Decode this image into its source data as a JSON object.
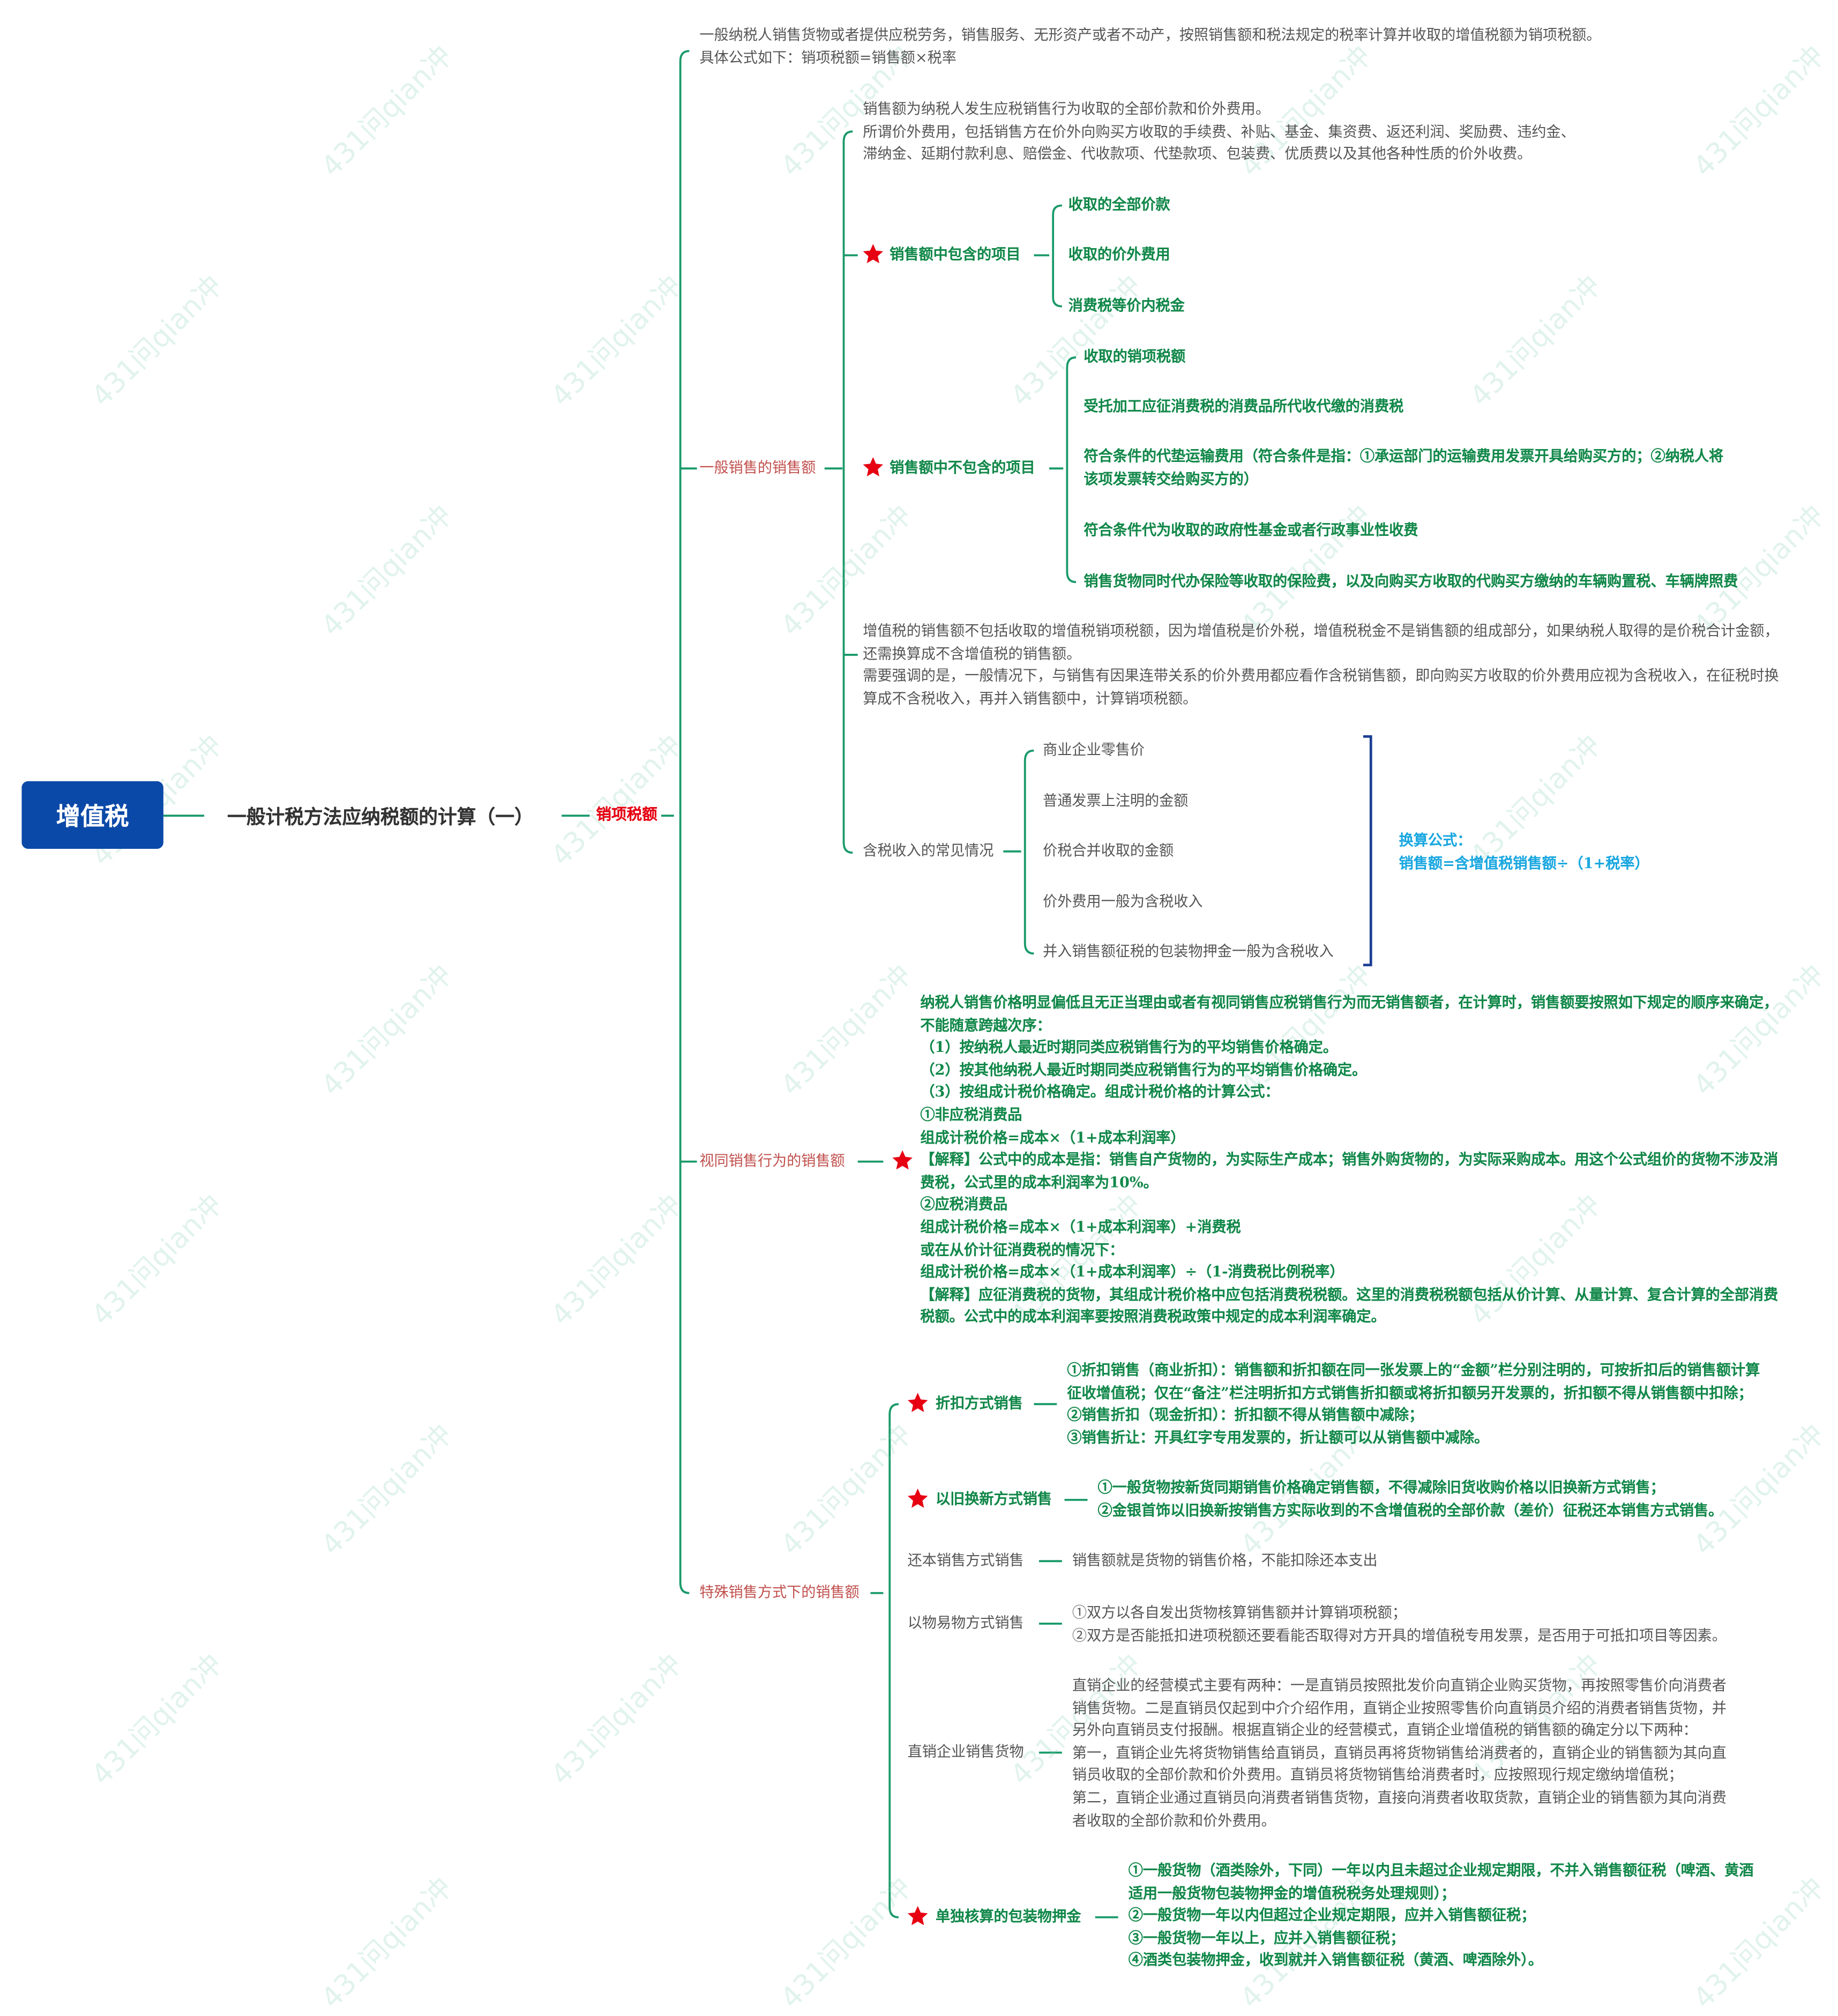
{
  "root": {
    "label": "增值税"
  },
  "l1": {
    "label": "一般计税方法应纳税额的计算（一）"
  },
  "l2": {
    "label": "销项税额"
  },
  "intro": {
    "text": "一般纳税人销售货物或者提供应税劳务，销售服务、无形资产或者不动产，按照销售额和税法规定的税率计算并收取的增值税额为销项税额。\n具体公式如下：销项税额=销售额×税率"
  },
  "general": {
    "label": "一般销售的销售额",
    "def_text": "销售额为纳税人发生应税销售行为收取的全部价款和价外费用。\n所谓价外费用，包括销售方在价外向购买方收取的手续费、补贴、基金、集资费、返还利润、奖励费、违约金、\n滞纳金、延期付款利息、赔偿金、代收款项、代垫款项、包装费、优质费以及其他各种性质的价外收费。",
    "included": {
      "label": "销售额中包含的项目",
      "items": [
        "收取的全部价款",
        "收取的价外费用",
        "消费税等价内税金"
      ]
    },
    "excluded": {
      "label": "销售额中不包含的项目",
      "items": [
        "收取的销项税额",
        "受托加工应征消费税的消费品所代收代缴的消费税",
        "符合条件的代垫运输费用（符合条件是指：①承运部门的运输费用发票开具给购买方的；②纳税人将\n该项发票转交给购买方的）",
        "符合条件代为收取的政府性基金或者行政事业性收费",
        "销售货物同时代办保险等收取的保险费，以及向购买方收取的代购买方缴纳的车辆购置税、车辆牌照费"
      ]
    },
    "note_text": "增值税的销售额不包括收取的增值税销项税额，因为增值税是价外税，增值税税金不是销售额的组成部分，如果纳税人取得的是价税合计金额，\n还需换算成不含增值税的销售额。\n需要强调的是，一般情况下，与销售有因果连带关系的价外费用都应看作含税销售额，即向购买方收取的价外费用应视为含税收入，在征税时换\n算成不含税收入，再并入销售额中，计算销项税额。",
    "tax_inclusive": {
      "label": "含税收入的常见情况",
      "items": [
        "商业企业零售价",
        "普通发票上注明的金额",
        "价税合并收取的金额",
        "价外费用一般为含税收入",
        "并入销售额征税的包装物押金一般为含税收入"
      ],
      "formula": "换算公式：\n销售额=含增值税销售额÷（1+税率）"
    }
  },
  "deemed": {
    "label": "视同销售行为的销售额",
    "text": "纳税人销售价格明显偏低且无正当理由或者有视同销售应税销售行为而无销售额者，在计算时，销售额要按照如下规定的顺序来确定，\n不能随意跨越次序：\n（1）按纳税人最近时期同类应税销售行为的平均销售价格确定。\n（2）按其他纳税人最近时期同类应税销售行为的平均销售价格确定。\n（3）按组成计税价格确定。组成计税价格的计算公式：\n①非应税消费品\n组成计税价格=成本×（1+成本利润率）\n【解释】公式中的成本是指：销售自产货物的，为实际生产成本；销售外购货物的，为实际采购成本。用这个公式组价的货物不涉及消\n费税，公式里的成本利润率为10%。\n②应税消费品\n组成计税价格=成本×（1+成本利润率）+消费税\n或在从价计征消费税的情况下：\n组成计税价格=成本×（1+成本利润率）÷（1-消费税比例税率）\n【解释】应征消费税的货物，其组成计税价格中应包括消费税税额。这里的消费税税额包括从价计算、从量计算、复合计算的全部消费\n税额。公式中的成本利润率要按照消费税政策中规定的成本利润率确定。"
  },
  "special": {
    "label": "特殊销售方式下的销售额",
    "items": [
      {
        "label": "折扣方式销售",
        "text": "①折扣销售（商业折扣）：销售额和折扣额在同一张发票上的“金额”栏分别注明的，可按折扣后的销售额计算\n征收增值税；仅在“备注”栏注明折扣方式销售折扣额或将折扣额另开发票的，折扣额不得从销售额中扣除；\n②销售折扣（现金折扣）：折扣额不得从销售额中减除；\n③销售折让：开具红字专用发票的，折让额可以从销售额中减除。"
      },
      {
        "label": "以旧换新方式销售",
        "text": "①一般货物按新货同期销售价格确定销售额，不得减除旧货收购价格以旧换新方式销售；\n②金银首饰以旧换新按销售方实际收到的不含增值税的全部价款（差价）征税还本销售方式销售。"
      },
      {
        "label": "还本销售方式销售",
        "text": "销售额就是货物的销售价格，不能扣除还本支出"
      },
      {
        "label": "以物易物方式销售",
        "text": "①双方以各自发出货物核算销售额并计算销项税额；\n②双方是否能抵扣进项税额还要看能否取得对方开具的增值税专用发票，是否用于可抵扣项目等因素。"
      },
      {
        "label": "直销企业销售货物",
        "text": "直销企业的经营模式主要有两种：一是直销员按照批发价向直销企业购买货物，再按照零售价向消费者\n销售货物。二是直销员仅起到中介介绍作用，直销企业按照零售价向直销员介绍的消费者销售货物，并\n另外向直销员支付报酬。根据直销企业的经营模式，直销企业增值税的销售额的确定分以下两种：\n第一，直销企业先将货物销售给直销员，直销员再将货物销售给消费者的，直销企业的销售额为其向直\n销员收取的全部价款和价外费用。直销员将货物销售给消费者时，应按照现行规定缴纳增值税；\n第二，直销企业通过直销员向消费者销售货物，直接向消费者收取货款，直销企业的销售额为其向消费\n者收取的全部价款和价外费用。"
      },
      {
        "label": "单独核算的包装物押金",
        "text": "①一般货物（酒类除外，下同）一年以内且未超过企业规定期限，不并入销售额征税（啤酒、黄酒\n适用一般货物包装物押金的增值税税务处理规则）；\n②一般货物一年以内但超过企业规定期限，应并入销售额征税；\n③一般货物一年以上，应并入销售额征税；\n④酒类包装物押金，收到就并入销售额征税（黄酒、啤酒除外）。"
      }
    ]
  },
  "watermark": "431问qian冲",
  "colors": {
    "root_bg": "#0b49a8",
    "line": "#1a9a6a",
    "accent_green": "#12884a",
    "accent_red": "#c0504d",
    "blue": "#1aa7e0",
    "bracket_blue": "#1c3f94",
    "star": "#e60012"
  }
}
